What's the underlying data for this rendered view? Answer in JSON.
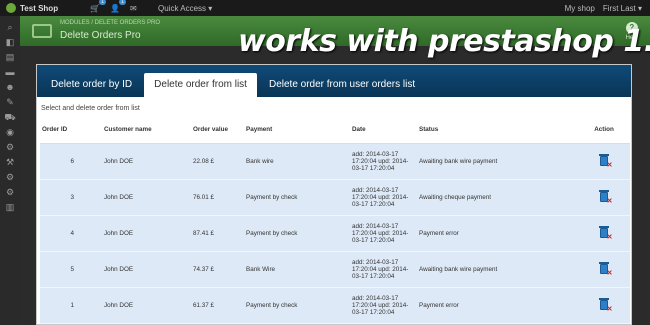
{
  "topbar": {
    "shop_name": "Test Shop",
    "badges": [
      "1",
      "1"
    ],
    "quick_access": "Quick Access ▾",
    "my_shop": "My shop",
    "user": "First Last ▾"
  },
  "header": {
    "breadcrumb": "MODULES   /   DELETE ORDERS PRO",
    "title": "Delete Orders Pro",
    "help": "Help"
  },
  "overlay_text": "works with prestashop 1.6",
  "tabs": [
    "Delete order by ID",
    "Delete order from list",
    "Delete order from user orders list"
  ],
  "section_title": "Select and delete order from list",
  "table": {
    "headers": [
      "Order ID",
      "Customer name",
      "Order value",
      "Payment",
      "Date",
      "Status",
      "Action"
    ],
    "rows": [
      {
        "id": "6",
        "customer": "John DOE",
        "value": "22.08 £",
        "payment": "Bank wire",
        "date": "add: 2014-03-17 17:20:04 upd: 2014-03-17 17:20:04",
        "status": "Awaiting bank wire payment"
      },
      {
        "id": "3",
        "customer": "John DOE",
        "value": "76.01 £",
        "payment": "Payment by check",
        "date": "add: 2014-03-17 17:20:04 upd: 2014-03-17 17:20:04",
        "status": "Awaiting cheque payment"
      },
      {
        "id": "4",
        "customer": "John DOE",
        "value": "87.41 £",
        "payment": "Payment by check",
        "date": "add: 2014-03-17 17:20:04 upd: 2014-03-17 17:20:04",
        "status": "Payment error"
      },
      {
        "id": "5",
        "customer": "John DOE",
        "value": "74.37 £",
        "payment": "Bank Wire",
        "date": "add: 2014-03-17 17:20:04 upd: 2014-03-17 17:20:04",
        "status": "Awaiting bank wire payment"
      },
      {
        "id": "1",
        "customer": "John DOE",
        "value": "61.37 £",
        "payment": "Payment by check",
        "date": "add: 2014-03-17 17:20:04 upd: 2014-03-17 17:20:04",
        "status": "Payment error"
      }
    ]
  },
  "colors": {
    "tab_bar": "#0d3d63",
    "row_bg": "#dde9f7",
    "header_green": "#3a7a32",
    "accent": "#2f7fc8"
  }
}
